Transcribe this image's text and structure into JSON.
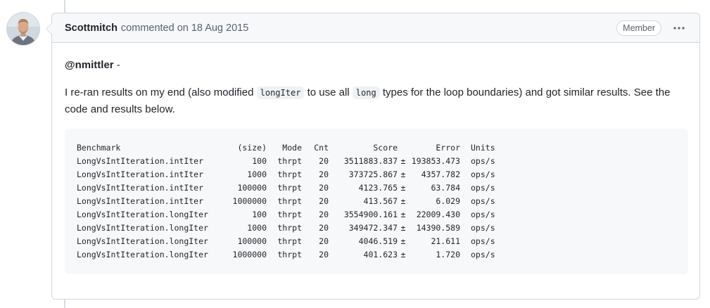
{
  "comment": {
    "author": "Scottmitch",
    "action": "commented on",
    "timestamp": "18 Aug 2015",
    "role_badge": "Member",
    "more_icon": "kebab-horizontal-icon",
    "avatar": "user-avatar",
    "body": {
      "mention": "@nmittler",
      "mention_suffix": " -",
      "paragraph_part1": "I re-ran results on my end (also modified ",
      "code1": "longIter",
      "paragraph_part2": " to use all ",
      "code2": "long",
      "paragraph_part3": " types for the loop boundaries) and got similar results. See the code and results below."
    },
    "benchmark_table": {
      "headers": {
        "benchmark": "Benchmark",
        "size": "(size)",
        "mode": "Mode",
        "cnt": "Cnt",
        "score": "Score",
        "pm": "",
        "error": "Error",
        "units": "Units"
      },
      "rows": [
        {
          "benchmark": "LongVsIntIteration.intIter",
          "size": "100",
          "mode": "thrpt",
          "cnt": "20",
          "score": "3511883.837",
          "pm": "±",
          "error": "193853.473",
          "units": "ops/s"
        },
        {
          "benchmark": "LongVsIntIteration.intIter",
          "size": "1000",
          "mode": "thrpt",
          "cnt": "20",
          "score": "373725.867",
          "pm": "±",
          "error": "4357.782",
          "units": "ops/s"
        },
        {
          "benchmark": "LongVsIntIteration.intIter",
          "size": "100000",
          "mode": "thrpt",
          "cnt": "20",
          "score": "4123.765",
          "pm": "±",
          "error": "63.784",
          "units": "ops/s"
        },
        {
          "benchmark": "LongVsIntIteration.intIter",
          "size": "1000000",
          "mode": "thrpt",
          "cnt": "20",
          "score": "413.567",
          "pm": "±",
          "error": "6.029",
          "units": "ops/s"
        },
        {
          "benchmark": "LongVsIntIteration.longIter",
          "size": "100",
          "mode": "thrpt",
          "cnt": "20",
          "score": "3554900.161",
          "pm": "±",
          "error": "22009.430",
          "units": "ops/s"
        },
        {
          "benchmark": "LongVsIntIteration.longIter",
          "size": "1000",
          "mode": "thrpt",
          "cnt": "20",
          "score": "349472.347",
          "pm": "±",
          "error": "14390.589",
          "units": "ops/s"
        },
        {
          "benchmark": "LongVsIntIteration.longIter",
          "size": "100000",
          "mode": "thrpt",
          "cnt": "20",
          "score": "4046.519",
          "pm": "±",
          "error": "21.611",
          "units": "ops/s"
        },
        {
          "benchmark": "LongVsIntIteration.longIter",
          "size": "1000000",
          "mode": "thrpt",
          "cnt": "20",
          "score": "401.623",
          "pm": "±",
          "error": "1.720",
          "units": "ops/s"
        }
      ]
    }
  }
}
